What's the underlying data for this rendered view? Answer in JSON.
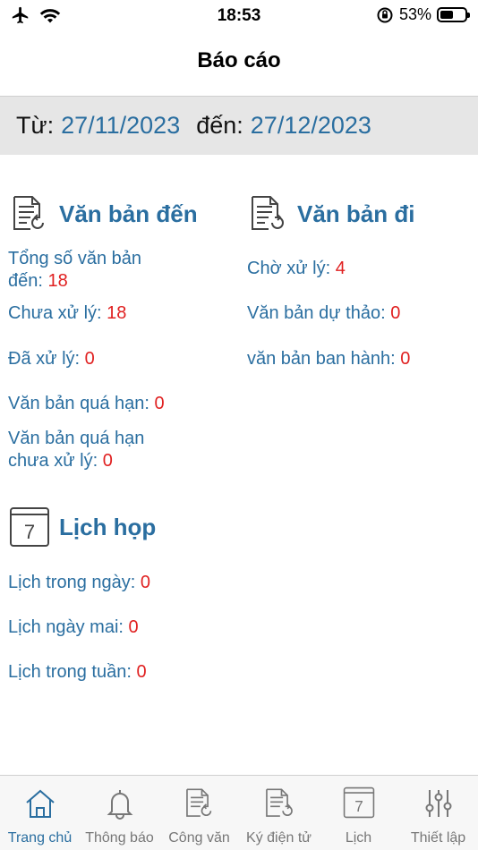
{
  "status_bar": {
    "time": "18:53",
    "battery_percent_label": "53%",
    "battery_level": 0.53,
    "icons": [
      "airplane-icon",
      "wifi-icon",
      "orientation-lock-icon",
      "battery-icon"
    ]
  },
  "header": {
    "title": "Báo cáo"
  },
  "date_range": {
    "from_label": "Từ:",
    "from_value": "27/11/2023",
    "to_label": "đến:",
    "to_value": "27/12/2023"
  },
  "incoming": {
    "title": "Văn bản đến",
    "icon": "document-incoming-icon",
    "rows": [
      {
        "label_line1": "Tổng số văn bản",
        "label_line2": "đến:",
        "value": "18"
      },
      {
        "label": "Chưa xử lý:",
        "value": "18"
      },
      {
        "label": "Đã xử lý:",
        "value": "0"
      },
      {
        "label": "Văn bản quá hạn:",
        "value": "0"
      },
      {
        "label_line1": "Văn bản quá hạn",
        "label_line2": "chưa xử lý:",
        "value": "0"
      }
    ]
  },
  "outgoing": {
    "title": "Văn bản đi",
    "icon": "document-outgoing-icon",
    "rows": [
      {
        "label": "Chờ xử lý:",
        "value": "4"
      },
      {
        "label": "Văn bản dự thảo:",
        "value": "0"
      },
      {
        "label": "văn bản ban hành:",
        "value": "0"
      }
    ]
  },
  "meetings": {
    "title": "Lịch họp",
    "icon": "calendar-icon",
    "icon_day": "7",
    "rows": [
      {
        "label": "Lịch trong ngày:",
        "value": "0"
      },
      {
        "label": "Lịch ngày mai:",
        "value": "0"
      },
      {
        "label": "Lịch trong tuần:",
        "value": "0"
      }
    ]
  },
  "tab_bar": {
    "active_color": "#2a6ea0",
    "inactive_color": "#777777",
    "items": [
      {
        "label": "Trang chủ",
        "icon": "home-icon",
        "active": true
      },
      {
        "label": "Thông báo",
        "icon": "bell-icon",
        "active": false
      },
      {
        "label": "Công văn",
        "icon": "document-icon",
        "active": false
      },
      {
        "label": "Ký điện tử",
        "icon": "e-sign-icon",
        "active": false
      },
      {
        "label": "Lịch",
        "icon": "calendar-icon",
        "icon_day": "7",
        "active": false
      },
      {
        "label": "Thiết lập",
        "icon": "sliders-icon",
        "active": false
      }
    ]
  }
}
